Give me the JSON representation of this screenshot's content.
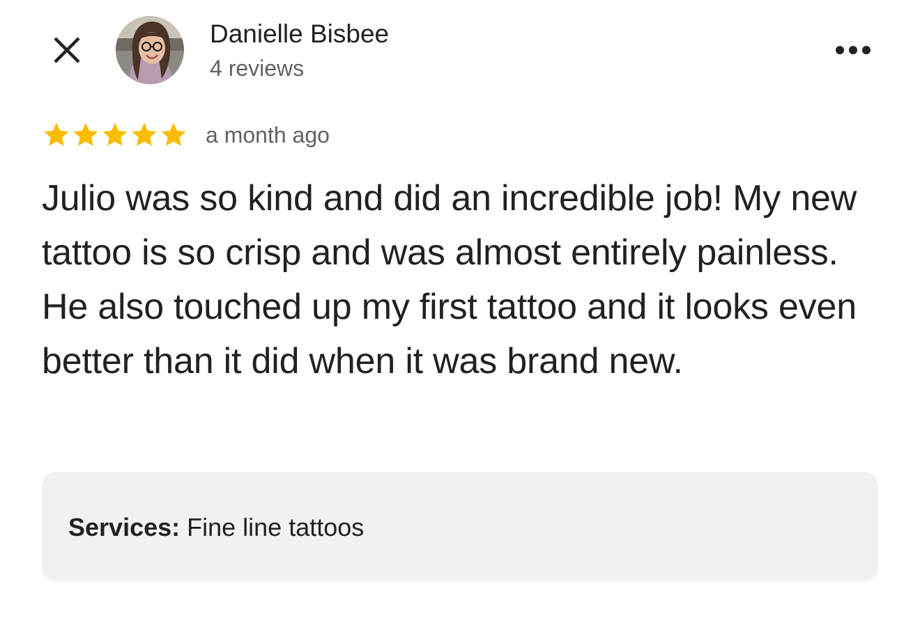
{
  "header": {
    "close_icon": "close-icon",
    "avatar_icon": "reviewer-avatar",
    "reviewer_name": "Danielle Bisbee",
    "reviewer_meta": "4 reviews",
    "more_icon": "more-horiz-icon"
  },
  "review": {
    "rating": 5,
    "rating_max": 5,
    "star_color": "#FBBC04",
    "time": "a month ago",
    "text": "Julio was so kind and did an incredible job! My new tattoo is so crisp and was almost entirely painless. He also touched up my first tattoo and it looks even better than it did when it was brand new."
  },
  "services": {
    "label": "Services:",
    "value": " Fine line tattoos",
    "background": "#F1F1F1"
  }
}
